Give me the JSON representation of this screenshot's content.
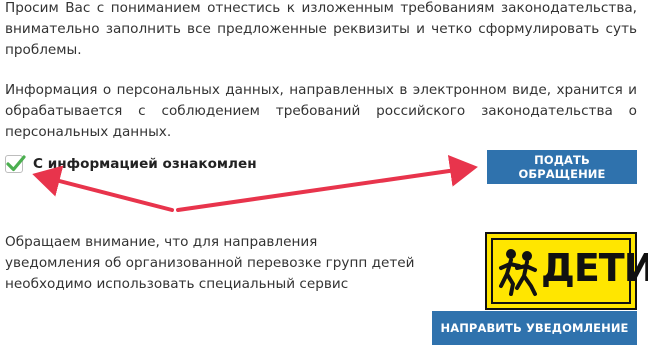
{
  "intro": {
    "paragraph1": "Просим Вас с пониманием отнестись к изложенным требованиям законодательства, внимательно заполнить все предложенные реквизиты и четко сформулировать суть проблемы.",
    "paragraph2": "Информация о персональных данных, направленных в электронном виде, хранится и обрабатывается с соблюдением требований российского законодательства о персональных данных."
  },
  "consent": {
    "label": "С информацией ознакомлен",
    "checked": true
  },
  "buttons": {
    "submit_label": "ПОДАТЬ ОБРАЩЕНИЕ",
    "notify_label": "НАПРАВИТЬ УВЕДОМЛЕНИЕ"
  },
  "notice": {
    "text": "Обращаем внимание, что для направления уведомления об организованной перевозке групп детей необходимо использовать специальный сервис"
  },
  "kids_sign": {
    "text": "ДЕТИ",
    "icon": "running-children-icon",
    "background": "#ffe600"
  },
  "colors": {
    "button": "#2f72ad",
    "arrow": "#e8344c",
    "check": "#4caf50"
  }
}
